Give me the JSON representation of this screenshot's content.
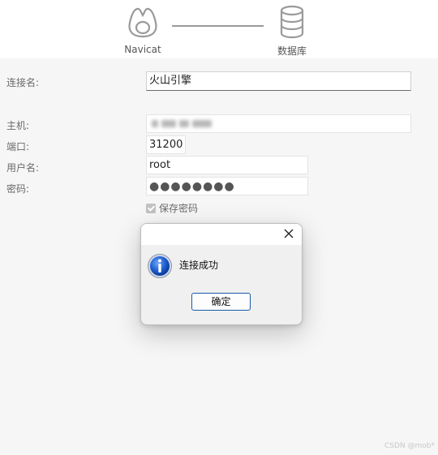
{
  "wizard": {
    "steps": [
      {
        "label": "Navicat",
        "icon": "navicat-logo-icon"
      },
      {
        "label": "数据库",
        "icon": "database-icon"
      }
    ]
  },
  "form": {
    "connection_name": {
      "label": "连接名:",
      "value": "火山引擎"
    },
    "host": {
      "label": "主机:",
      "value": ""
    },
    "port": {
      "label": "端口:",
      "value": "31200"
    },
    "username": {
      "label": "用户名:",
      "value": "root"
    },
    "password": {
      "label": "密码:",
      "value": "●●●●●●●●"
    },
    "save_password": {
      "label": "保存密码",
      "checked": true
    }
  },
  "dialog": {
    "message": "连接成功",
    "ok_label": "确定",
    "icon": "info-icon"
  },
  "watermark": "CSDN @mob*"
}
